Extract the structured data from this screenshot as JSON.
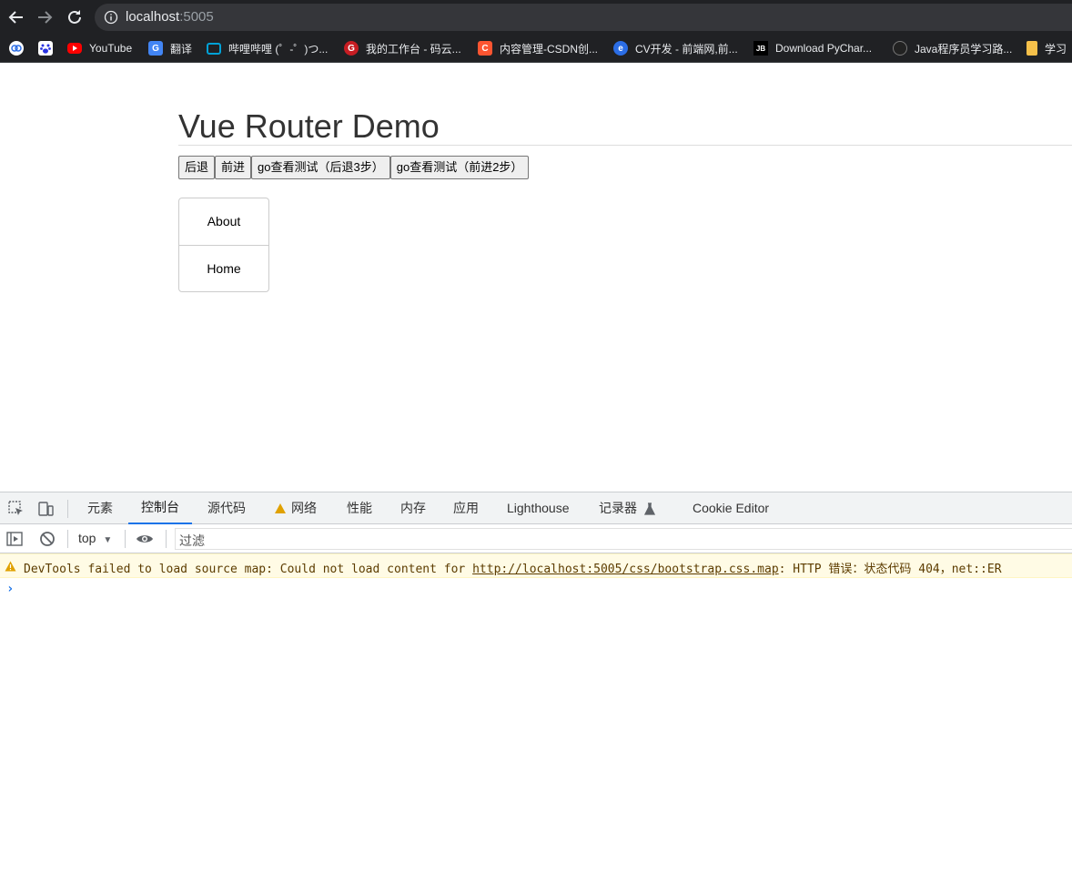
{
  "browser": {
    "url_host": "localhost",
    "url_port": ":5005",
    "bookmarks": [
      {
        "label": "",
        "icon": "cloud-icon",
        "color": "#ffffff"
      },
      {
        "label": "",
        "icon": "baidu-paw-icon",
        "color": "#2932e1"
      },
      {
        "label": "YouTube",
        "icon": "youtube-icon",
        "color": "#ff0000"
      },
      {
        "label": "翻译",
        "icon": "google-translate-icon",
        "color": "#4285f4"
      },
      {
        "label": "哔哩哔哩 (゜-゜)つ...",
        "icon": "bilibili-icon",
        "color": "#00a1d6"
      },
      {
        "label": "我的工作台 - 码云...",
        "icon": "gitee-icon",
        "color": "#c71d23"
      },
      {
        "label": "内容管理-CSDN创...",
        "icon": "csdn-icon",
        "color": "#fc5531"
      },
      {
        "label": "CV开发 - 前端网,前...",
        "icon": "qianduan-icon",
        "color": "#2b6de5"
      },
      {
        "label": "Download PyChar...",
        "icon": "jetbrains-icon",
        "color": "#000000"
      },
      {
        "label": "Java程序员学习路...",
        "icon": "globe-icon",
        "color": "#555555"
      },
      {
        "label": "学习",
        "icon": "folder-icon",
        "color": "#f5c04a"
      }
    ]
  },
  "page": {
    "title": "Vue Router Demo",
    "buttons": {
      "back": "后退",
      "forward": "前进",
      "go_back3": "go查看测试（后退3步）",
      "go_forward2": "go查看测试（前进2步）"
    },
    "nav_links": {
      "about": "About",
      "home": "Home"
    }
  },
  "devtools": {
    "tabs": {
      "elements": "元素",
      "console": "控制台",
      "sources": "源代码",
      "network": "网络",
      "performance": "性能",
      "memory": "内存",
      "application": "应用",
      "lighthouse": "Lighthouse",
      "recorder": "记录器",
      "cookie_editor": "Cookie Editor"
    },
    "context": "top",
    "filter_placeholder": "过滤",
    "warning": {
      "prefix": "DevTools failed to load source map: Could not load content for ",
      "link": "http://localhost:5005/css/bootstrap.css.map",
      "suffix": ": HTTP 错误：状态代码 404，net::ER"
    },
    "prompt": "›"
  }
}
